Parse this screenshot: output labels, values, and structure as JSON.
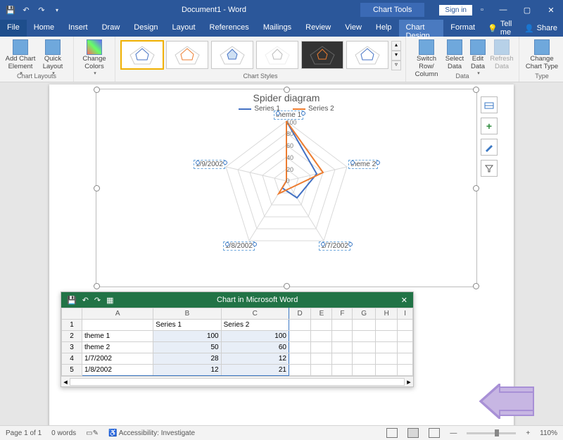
{
  "title": {
    "doc": "Document1 - Word",
    "context": "Chart Tools",
    "signin": "Sign in"
  },
  "tabs": {
    "file": "File",
    "items": [
      "Home",
      "Insert",
      "Draw",
      "Design",
      "Layout",
      "References",
      "Mailings",
      "Review",
      "View",
      "Help",
      "Chart Design",
      "Format"
    ],
    "active": "Chart Design",
    "tellme": "Tell me",
    "share": "Share"
  },
  "ribbon": {
    "chart_layouts": {
      "label": "Chart Layouts",
      "add": "Add Chart\nElement",
      "quick": "Quick\nLayout"
    },
    "change_colors": "Change\nColors",
    "chart_styles": "Chart Styles",
    "data": {
      "label": "Data",
      "switch": "Switch Row/\nColumn",
      "select": "Select\nData",
      "edit": "Edit\nData",
      "refresh": "Refresh\nData"
    },
    "type": {
      "label": "Type",
      "change": "Change\nChart Type"
    }
  },
  "chart_data": {
    "type": "radar",
    "title": "Spider diagram",
    "categories": [
      "theme 1",
      "theme 2",
      "1/7/2002",
      "1/8/2002",
      "1/9/2002"
    ],
    "series": [
      {
        "name": "Series 1",
        "color": "#4472c4",
        "values": [
          100,
          50,
          28,
          12,
          null
        ]
      },
      {
        "name": "Series 2",
        "color": "#ed7d31",
        "values": [
          100,
          60,
          12,
          21,
          null
        ]
      }
    ],
    "axis_ticks": [
      0,
      20,
      40,
      60,
      80,
      100
    ],
    "rlim": [
      0,
      100
    ]
  },
  "mini": {
    "title": "Chart in Microsoft Word",
    "cols": [
      "",
      "A",
      "B",
      "C",
      "D",
      "E",
      "F",
      "G",
      "H",
      "I"
    ],
    "headers": {
      "B": "Series 1",
      "C": "Series 2"
    },
    "rows": [
      {
        "n": 1,
        "A": "",
        "B": "Series 1",
        "C": "Series 2"
      },
      {
        "n": 2,
        "A": "theme 1",
        "B": 100,
        "C": 100
      },
      {
        "n": 3,
        "A": "theme 2",
        "B": 50,
        "C": 60
      },
      {
        "n": 4,
        "A": "1/7/2002",
        "B": 28,
        "C": 12
      },
      {
        "n": 5,
        "A": "1/8/2002",
        "B": 12,
        "C": 21
      }
    ]
  },
  "status": {
    "page": "Page 1 of 1",
    "words": "0 words",
    "a11y": "Accessibility: Investigate",
    "zoom": "110%"
  }
}
